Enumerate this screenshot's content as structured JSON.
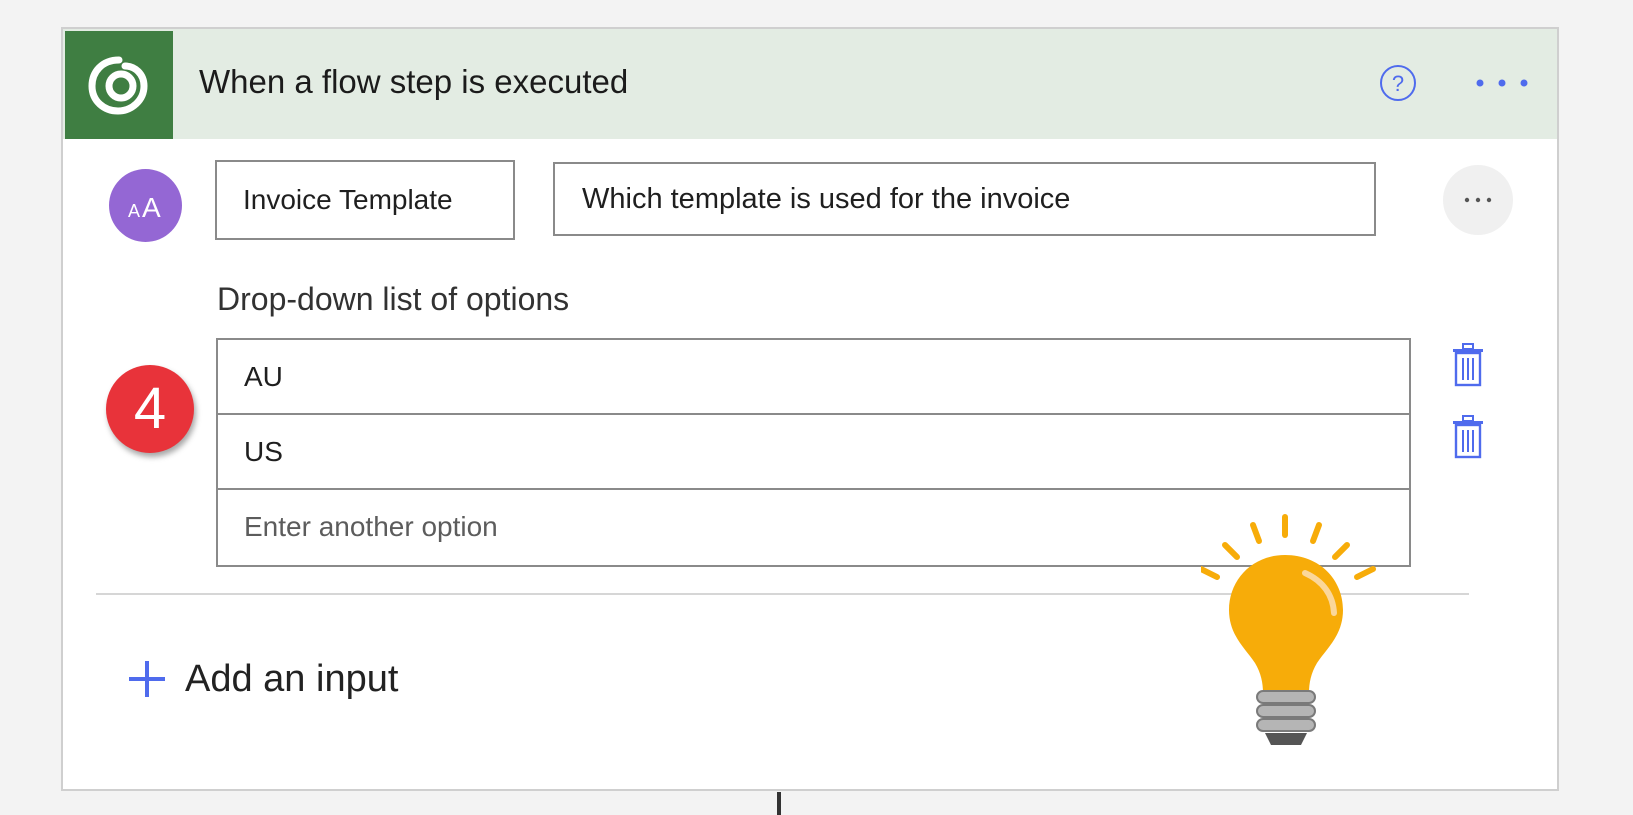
{
  "header": {
    "title": "When a flow step is executed",
    "accent_color": "#3f7e42",
    "icons": [
      "dataverse-logo-icon",
      "help-icon",
      "more-options-icon"
    ]
  },
  "input": {
    "avatar_text": "AA",
    "name_value": "Invoice Template",
    "description_value": "Which template is used for the invoice",
    "more_label": "···"
  },
  "dropdown": {
    "label": "Drop-down list of options",
    "options": [
      "AU",
      "US"
    ],
    "placeholder": "Enter another option"
  },
  "step_badge": "4",
  "add_input_label": "Add an input",
  "colors": {
    "badge": "#e8333a",
    "avatar": "#9467d4",
    "link_blue": "#4f6bed",
    "bulb": "#f7ac09"
  }
}
